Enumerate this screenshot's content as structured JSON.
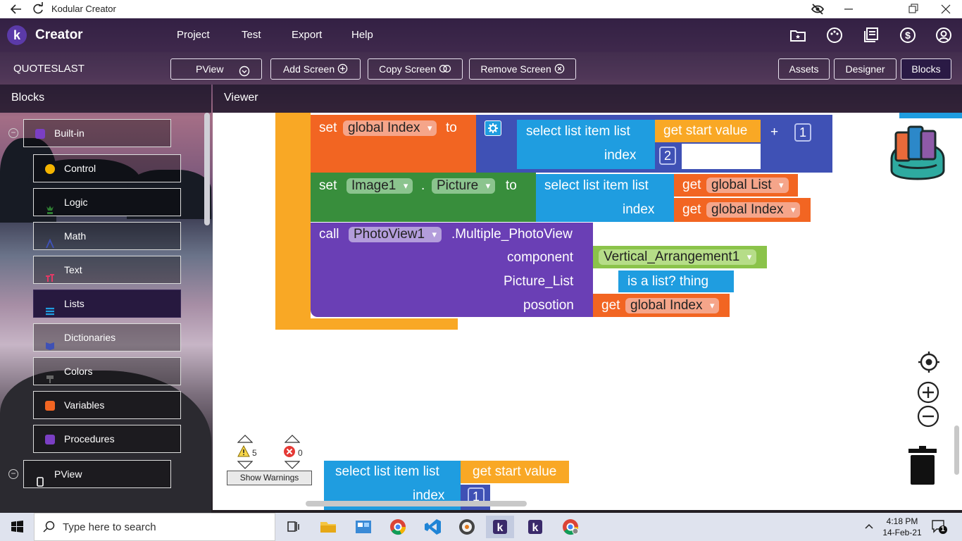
{
  "window": {
    "title": "Kodular Creator"
  },
  "appbar": {
    "logo_letter": "k",
    "brand": "Creator",
    "menu": [
      "Project",
      "Test",
      "Export",
      "Help"
    ]
  },
  "screenbar": {
    "project": "QUOTESLAST",
    "screen_selector": "PView",
    "add_screen": "Add Screen",
    "copy_screen": "Copy Screen",
    "remove_screen": "Remove Screen",
    "assets": "Assets",
    "designer": "Designer",
    "blocks": "Blocks"
  },
  "panels": {
    "blocks": "Blocks",
    "viewer": "Viewer"
  },
  "sidebar": {
    "builtin": "Built-in",
    "items": [
      {
        "label": "Control",
        "color": "#f4b400"
      },
      {
        "label": "Logic",
        "color": "#2e7d32"
      },
      {
        "label": "Math",
        "color": "#3f51b5"
      },
      {
        "label": "Text",
        "color": "#e53966"
      },
      {
        "label": "Lists",
        "color": "#1f9de0"
      },
      {
        "label": "Dictionaries",
        "color": "#3f51b5"
      },
      {
        "label": "Colors",
        "color": "#555555"
      },
      {
        "label": "Variables",
        "color": "#f26522"
      },
      {
        "label": "Procedures",
        "color": "#7b3fc4"
      }
    ],
    "pview": "PView"
  },
  "blocks": {
    "set1": {
      "set": "set",
      "var": "global Index",
      "to": "to"
    },
    "select1": {
      "label": "select list item  list",
      "index": "index",
      "get_start": "get start value",
      "plus": "+",
      "one": "1",
      "two": "2"
    },
    "set2": {
      "set": "set",
      "component": "Image1",
      "dot": ".",
      "prop": "Picture",
      "to": "to"
    },
    "select2": {
      "label": "select list item  list",
      "index": "index",
      "get1": "get",
      "var1": "global List",
      "get2": "get",
      "var2": "global Index"
    },
    "call": {
      "call": "call",
      "component": "PhotoView1",
      "method": ".Multiple_PhotoView",
      "arg1": "component",
      "arg2": "Picture_List",
      "arg3": "posotion",
      "arg1_value": "Vertical_Arrangement1",
      "islist": "is a list?  thing",
      "get": "get",
      "var": "global Index"
    },
    "loose": {
      "label": "select list item  list",
      "index": "index",
      "get_start": "get start value",
      "one": "1"
    }
  },
  "warnings": {
    "warn_count": "5",
    "error_count": "0",
    "button": "Show Warnings"
  },
  "taskbar": {
    "search_placeholder": "Type here to search",
    "time": "4:18 PM",
    "date": "14-Feb-21",
    "notifications": "1"
  }
}
